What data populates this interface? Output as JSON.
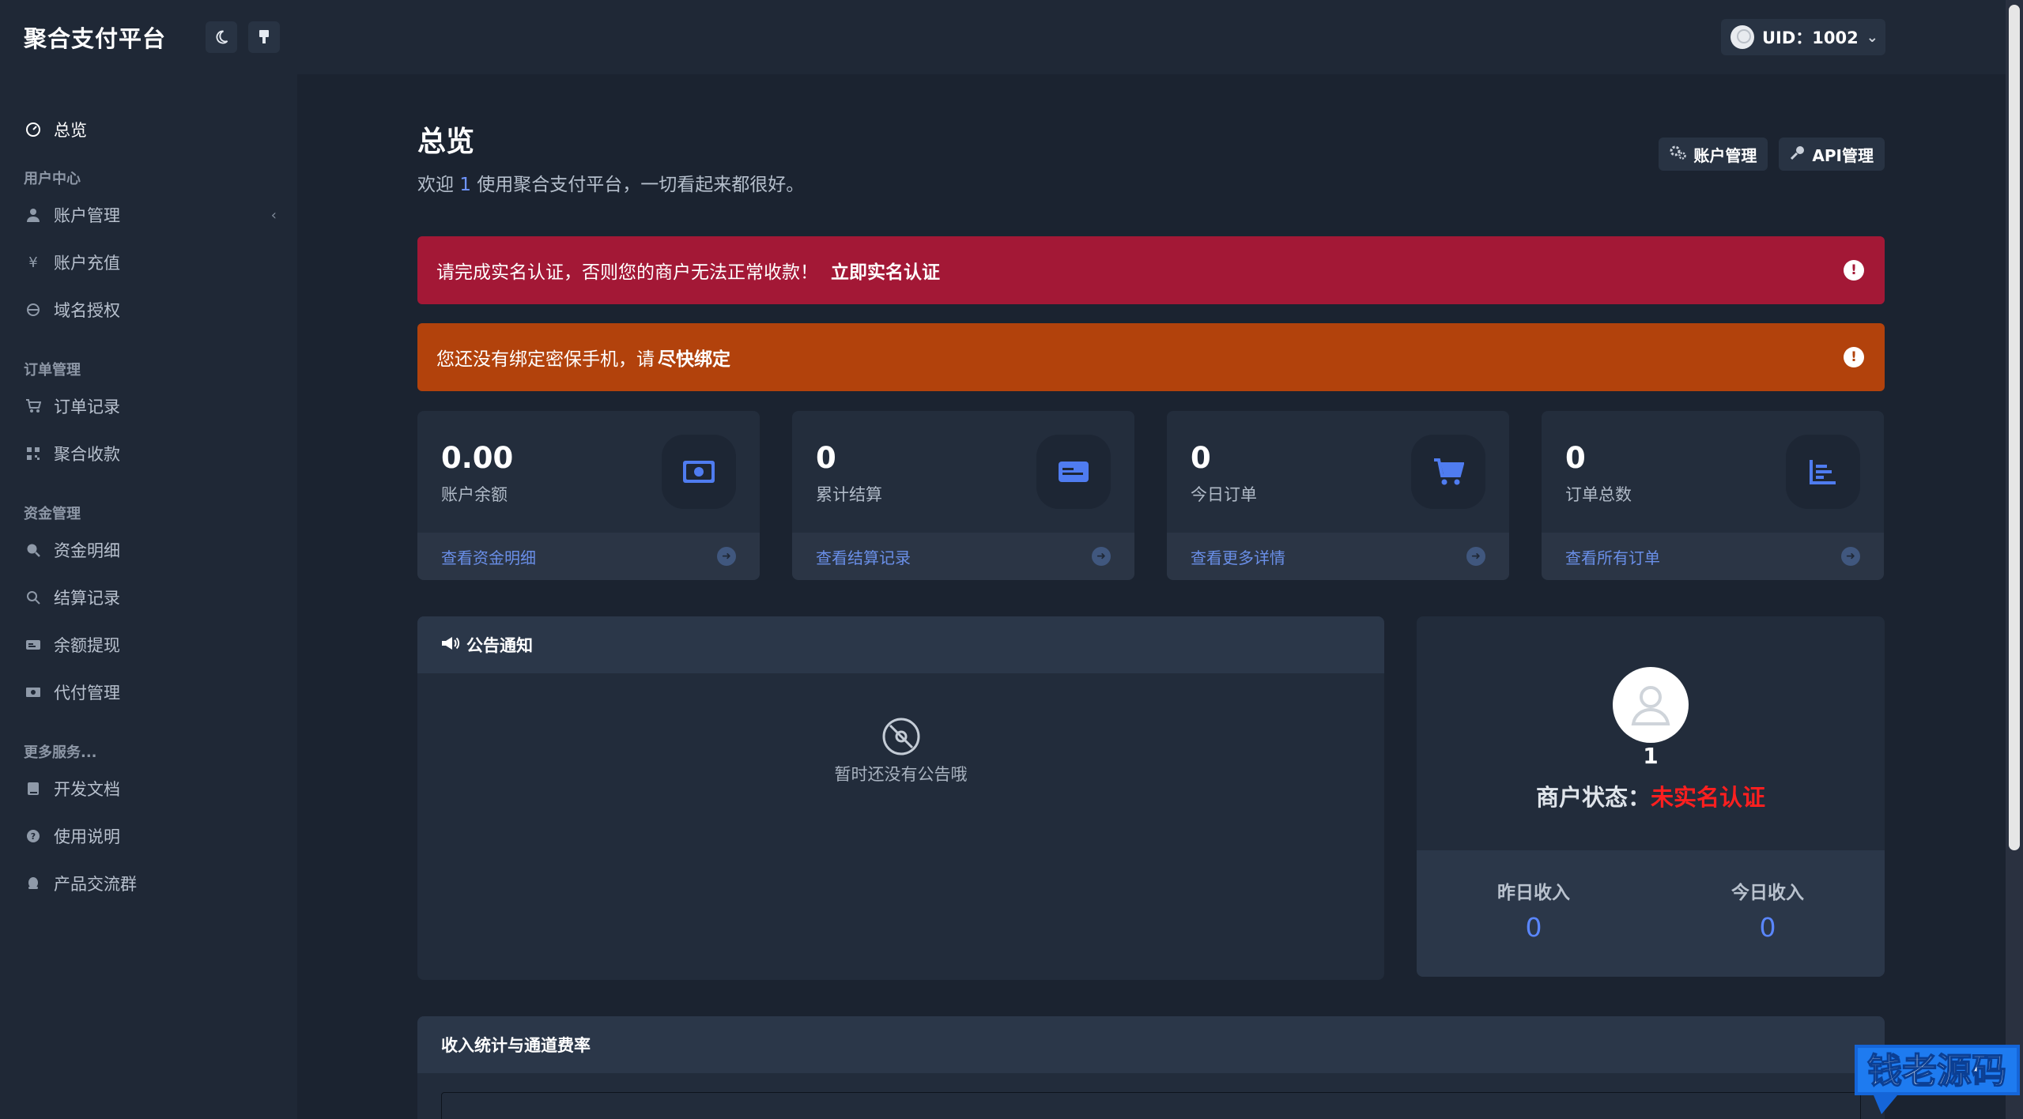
{
  "brand": {
    "title": "聚合支付平台"
  },
  "topbar": {
    "user_label": "UID：1002"
  },
  "sidebar": {
    "overview": "总览",
    "sections": [
      {
        "heading": "用户中心",
        "items": [
          "账户管理",
          "账户充值",
          "域名授权"
        ]
      },
      {
        "heading": "订单管理",
        "items": [
          "订单记录",
          "聚合收款"
        ]
      },
      {
        "heading": "资金管理",
        "items": [
          "资金明细",
          "结算记录",
          "余额提现",
          "代付管理"
        ]
      },
      {
        "heading": "更多服务...",
        "items": [
          "开发文档",
          "使用说明",
          "产品交流群"
        ]
      }
    ]
  },
  "header": {
    "title": "总览",
    "welcome_prefix": "欢迎",
    "welcome_user": "1",
    "welcome_suffix": "使用聚合支付平台，一切看起来都很好。",
    "account_btn": "账户管理",
    "api_btn": "API管理"
  },
  "alerts": {
    "realname_text": "请完成实名认证，否则您的商户无法正常收款！",
    "realname_link": "立即实名认证",
    "phone_text": "您还没有绑定密保手机，请",
    "phone_link": "尽快绑定"
  },
  "stats": [
    {
      "value": "0.00",
      "label": "账户余额",
      "link": "查看资金明细",
      "icon": "money-icon"
    },
    {
      "value": "0",
      "label": "累计结算",
      "link": "查看结算记录",
      "icon": "card-icon"
    },
    {
      "value": "0",
      "label": "今日订单",
      "link": "查看更多详情",
      "icon": "cart-icon"
    },
    {
      "value": "0",
      "label": "订单总数",
      "link": "查看所有订单",
      "icon": "chart-icon"
    }
  ],
  "notice": {
    "title": "公告通知",
    "empty": "暂时还没有公告哦"
  },
  "profile": {
    "uid": "1",
    "status_label": "商户状态：",
    "status_value": "未实名认证",
    "yesterday_label": "昨日收入",
    "yesterday_value": "0",
    "today_label": "今日收入",
    "today_value": "0"
  },
  "income_panel": {
    "title": "收入统计与通道费率"
  },
  "watermark": {
    "text": "钱老源码"
  },
  "colors": {
    "accent": "#6f95ff",
    "danger": "#a31836",
    "warning": "#b2420c",
    "status_warn": "#ff1f1f"
  }
}
